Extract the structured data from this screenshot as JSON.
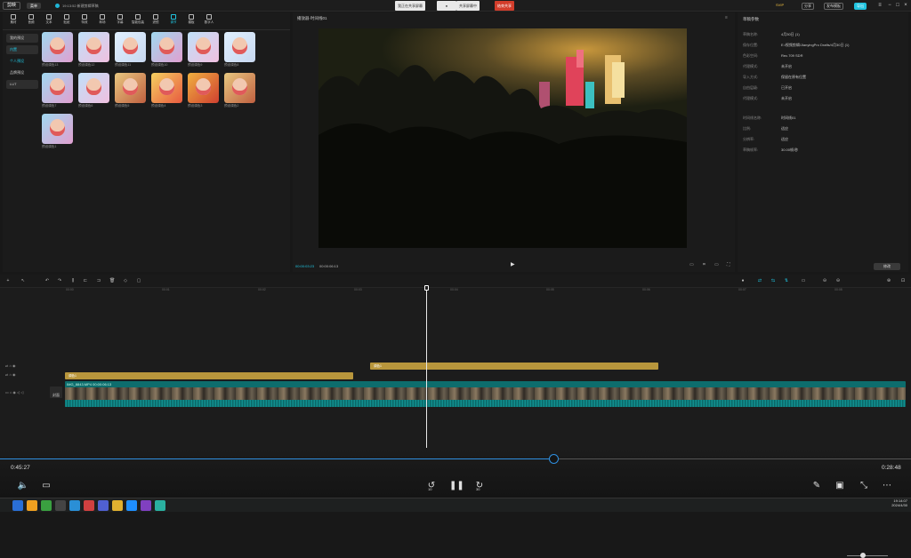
{
  "app": {
    "logo": "剪映",
    "menu": "菜单",
    "project": "19:13:52 新建剪辑草稿"
  },
  "share": {
    "screen": "我正在共享屏幕",
    "start": "共享屏幕中",
    "stop": "结束共享"
  },
  "topright": {
    "vip": "SVIP",
    "share": "分享",
    "publish": "发布模板",
    "export": "导出"
  },
  "tools": [
    "素材",
    "音频",
    "文本",
    "贴纸",
    "特效",
    "转场",
    "字幕",
    "智能包装",
    "滤镜",
    "调节",
    "模板",
    "数字人"
  ],
  "categories": [
    "我的预设",
    "内置",
    "个人预设",
    "品牌预设",
    "LUT"
  ],
  "presets": [
    "预设调色13",
    "预设调色12",
    "预设调色11",
    "预设调色10",
    "预设调色9",
    "预设调色8",
    "预设调色7",
    "预设调色6",
    "预设调色5",
    "预设调色4",
    "预设调色3",
    "预设调色2",
    "预设调色1"
  ],
  "preview": {
    "title": "播放器·时间线01",
    "current": "00:00:03:23",
    "total": "00:00:06:13"
  },
  "props": {
    "header": "草稿参数",
    "rows": [
      {
        "k": "草稿名称:",
        "v": "4月30日 (1)"
      },
      {
        "k": "保存位置:",
        "v": "E:/视频剪辑/JianyingPro Drafts/4月30日 (1)"
      },
      {
        "k": "色彩空间:",
        "v": "Rec.709 SDR"
      },
      {
        "k": "代理模式:",
        "v": "未开启"
      },
      {
        "k": "导入方式:",
        "v": "保留在原有位置"
      },
      {
        "k": "自由层级:",
        "v": "已开启"
      },
      {
        "k": "代理模式:",
        "v": "未开启"
      },
      {
        "k": "时间线名称:",
        "v": "时间线01"
      },
      {
        "k": "比例:",
        "v": "适应"
      },
      {
        "k": "分辨率:",
        "v": "适应"
      },
      {
        "k": "草稿帧率:",
        "v": "30.00帧/秒"
      }
    ],
    "edit": "修改"
  },
  "ruler": [
    "00:00",
    "00:01",
    "00:02",
    "00:03",
    "00:04",
    "00:05",
    "00:06",
    "00:07",
    "00:08"
  ],
  "tracks": {
    "adjust_label": "调色1",
    "video_label": "IMG_8843.MP4  00:00:06:13",
    "cover": "封面"
  },
  "player": {
    "elapsed": "0:45:27",
    "remaining": "0:28:48",
    "rewind": "10",
    "forward": "30"
  },
  "clock": {
    "time": "19:14:07",
    "date": "2024/4/30"
  },
  "colors": {
    "accent": "#20c4e0",
    "clip": "#b8963c",
    "videoTrack": "#0d6d6d",
    "seek": "#2f8fdf"
  }
}
